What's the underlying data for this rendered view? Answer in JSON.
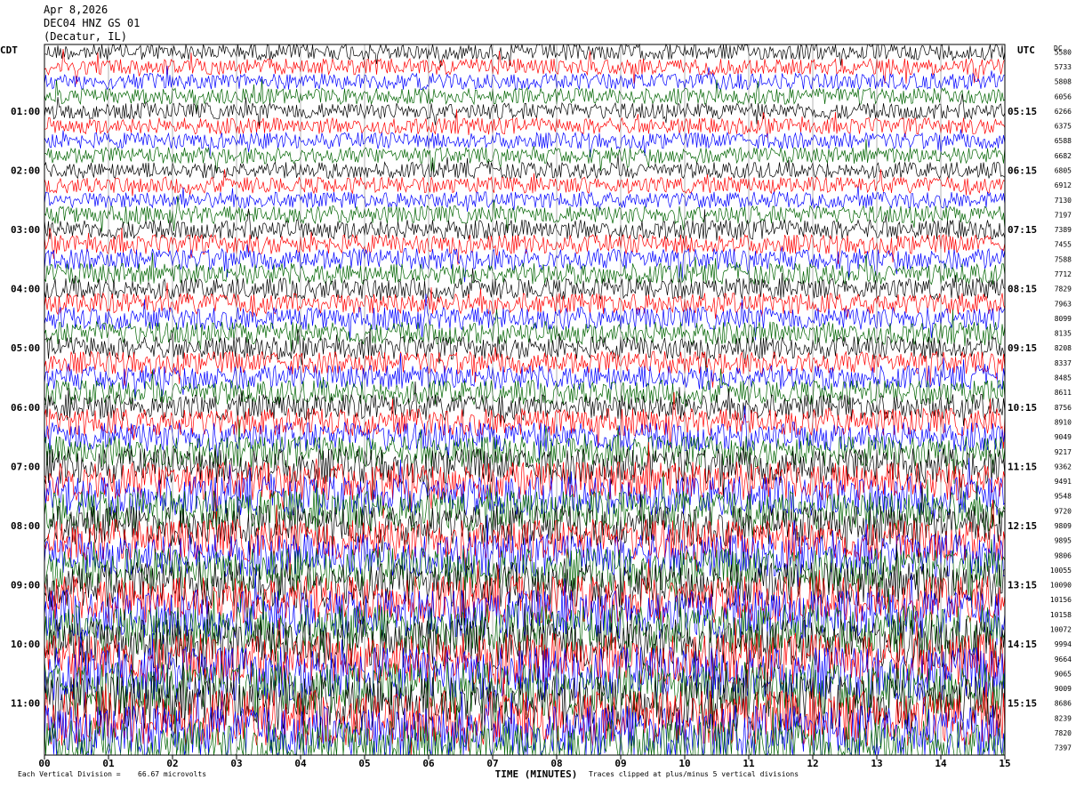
{
  "header": {
    "date": "Apr 8,2026",
    "station": "DEC04 HNZ GS 01",
    "location": "(Decatur, IL)"
  },
  "left_timezone": "CDT",
  "right_timezone": "UTC",
  "dc_label": "DC",
  "footer": {
    "scale_label": "Each Vertical Division =",
    "scale_value": "66.67 microvolts",
    "clip_note": "Traces clipped at plus/minus 5 vertical divisions"
  },
  "chart_data": {
    "type": "line",
    "title": "",
    "xlabel": "TIME (MINUTES)",
    "ylabel": "",
    "xlim": [
      0,
      15
    ],
    "x_ticks": [
      "00",
      "01",
      "02",
      "03",
      "04",
      "05",
      "06",
      "07",
      "08",
      "09",
      "10",
      "11",
      "12",
      "13",
      "14",
      "15"
    ],
    "rows_per_hour": 4,
    "minutes_per_row": 15,
    "trace_color_cycle": [
      "#000000",
      "#ff0000",
      "#0000ff",
      "#006400"
    ],
    "left_hour_labels": [
      "01:00",
      "02:00",
      "03:00",
      "04:00",
      "05:00",
      "06:00",
      "07:00",
      "08:00",
      "09:00",
      "10:00",
      "11:00"
    ],
    "right_hour_labels": [
      "05:15",
      "06:15",
      "07:15",
      "08:15",
      "09:15",
      "10:15",
      "11:15",
      "12:15",
      "13:15",
      "14:15",
      "15:15"
    ],
    "dc_offsets": [
      "5580",
      "5733",
      "5808",
      "6056",
      "6266",
      "6375",
      "6588",
      "6682",
      "6805",
      "6912",
      "7130",
      "7197",
      "7389",
      "7455",
      "7588",
      "7712",
      "7829",
      "7963",
      "8099",
      "8135",
      "8208",
      "8337",
      "8485",
      "8611",
      "8756",
      "8910",
      "9049",
      "9217",
      "9362",
      "9491",
      "9548",
      "9720",
      "9809",
      "9895",
      "9806",
      "10055",
      "10090",
      "10156",
      "10158",
      "10072",
      "9994",
      "9664",
      "9065",
      "9009",
      "8686",
      "8239",
      "7820",
      "7397"
    ],
    "noise_level_divisions": [
      1.0,
      1.0,
      1.0,
      1.0,
      1.0,
      1.0,
      1.0,
      1.0,
      1.0,
      1.0,
      1.0,
      1.1,
      1.2,
      1.2,
      1.3,
      1.3,
      1.3,
      1.3,
      1.4,
      1.4,
      1.4,
      1.4,
      1.5,
      1.5,
      1.6,
      1.7,
      1.8,
      1.9,
      2.2,
      2.4,
      2.4,
      2.5,
      2.5,
      2.6,
      2.6,
      2.7,
      2.8,
      2.9,
      3.0,
      3.1,
      3.1,
      3.2,
      3.3,
      3.3,
      3.4,
      3.4,
      3.4,
      3.4
    ],
    "clip_divisions": 5
  }
}
